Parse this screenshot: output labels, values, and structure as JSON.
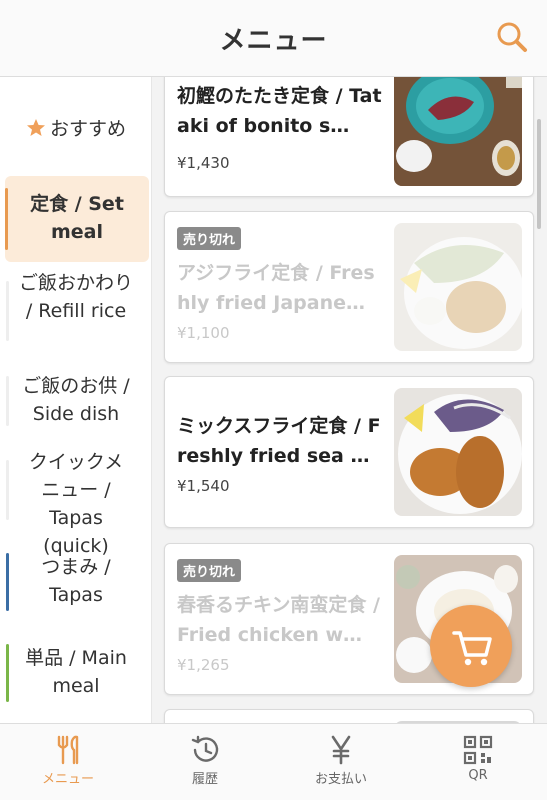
{
  "header": {
    "title": "メニュー",
    "search_icon": "search-icon"
  },
  "accent_color": "#e89a50",
  "sidebar": {
    "items": [
      {
        "label": "おすすめ",
        "icon": "star-icon",
        "active": false
      },
      {
        "label": "定食 / Set meal",
        "active": true,
        "bar_color": "#e89a50"
      },
      {
        "label": "ご飯おかわり / Refill rice",
        "active": false
      },
      {
        "label": "ご飯のお供 / Side dish",
        "active": false
      },
      {
        "label": "クイックメニュー / Tapas (quick)",
        "active": false
      },
      {
        "label": "つまみ / Tapas",
        "active": false,
        "bar_color": "#3b6ea5"
      },
      {
        "label": "単品 / Main meal",
        "active": false,
        "bar_color": "#7ab648"
      }
    ]
  },
  "menu": {
    "sold_out_label": "売り切れ",
    "items": [
      {
        "name": "初鰹のたたき定食 / Tataki of bonito s…",
        "price": "¥1,430",
        "sold_out": false
      },
      {
        "name": "アジフライ定食 / Freshly fried Japane…",
        "price": "¥1,100",
        "sold_out": true
      },
      {
        "name": "ミックスフライ定食 / Freshly fried sea …",
        "price": "¥1,540",
        "sold_out": false
      },
      {
        "name": "春香るチキン南蛮定食 / Fried chicken w…",
        "price": "¥1,265",
        "sold_out": true
      }
    ]
  },
  "cart_button": {
    "icon": "cart-icon"
  },
  "tabbar": {
    "tabs": [
      {
        "label": "メニュー",
        "icon": "utensils-icon",
        "active": true
      },
      {
        "label": "履歴",
        "icon": "history-icon",
        "active": false
      },
      {
        "label": "お支払い",
        "icon": "yen-icon",
        "active": false
      },
      {
        "label": "QR",
        "icon": "qr-icon",
        "active": false
      }
    ]
  }
}
